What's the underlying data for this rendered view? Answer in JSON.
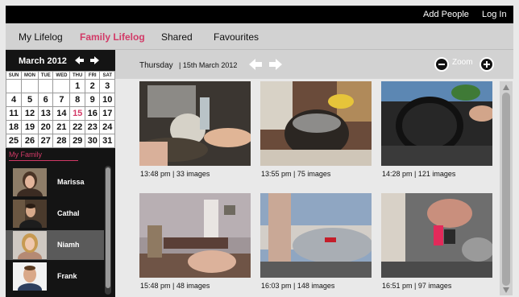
{
  "header": {
    "add_people": "Add People",
    "log_in": "Log In"
  },
  "tabs": [
    "My Lifelog",
    "Family Lifelog",
    "Shared",
    "Favourites"
  ],
  "active_tab": "Family Lifelog",
  "calendar": {
    "month": "March 2012",
    "days_of_week": [
      "SUN",
      "MON",
      "TUE",
      "WED",
      "THU",
      "FRI",
      "SAT"
    ],
    "weeks": [
      [
        "",
        "",
        "",
        "",
        "1",
        "2",
        "3"
      ],
      [
        "4",
        "5",
        "6",
        "7",
        "8",
        "9",
        "10"
      ],
      [
        "11",
        "12",
        "13",
        "14",
        "15",
        "16",
        "17"
      ],
      [
        "18",
        "19",
        "20",
        "21",
        "22",
        "23",
        "24"
      ],
      [
        "25",
        "26",
        "27",
        "28",
        "29",
        "30",
        "31"
      ]
    ],
    "selected_day": "15",
    "prev_icon": "arrow-left-icon",
    "next_icon": "arrow-right-icon"
  },
  "family": {
    "label": "My Family",
    "members": [
      {
        "name": "Marissa",
        "selected": false
      },
      {
        "name": "Cathal",
        "selected": false
      },
      {
        "name": "Niamh",
        "selected": true
      },
      {
        "name": "Frank",
        "selected": false
      }
    ]
  },
  "date_bar": {
    "day": "Thursday",
    "date": "| 15th March 2012",
    "zoom_label": "Zoom"
  },
  "photos": [
    {
      "caption": "13:48 pm |  33 images"
    },
    {
      "caption": "13:55 pm |  75 images"
    },
    {
      "caption": "14:28 pm | 121 images"
    },
    {
      "caption": "15:48 pm |  48 images"
    },
    {
      "caption": "16:03 pm |  148 images"
    },
    {
      "caption": "16:51 pm |  97 images"
    }
  ],
  "colors": {
    "accent": "#d23a67",
    "topbar": "#000000",
    "sidebar": "#141414",
    "selected_member": "#5a5a5a"
  }
}
